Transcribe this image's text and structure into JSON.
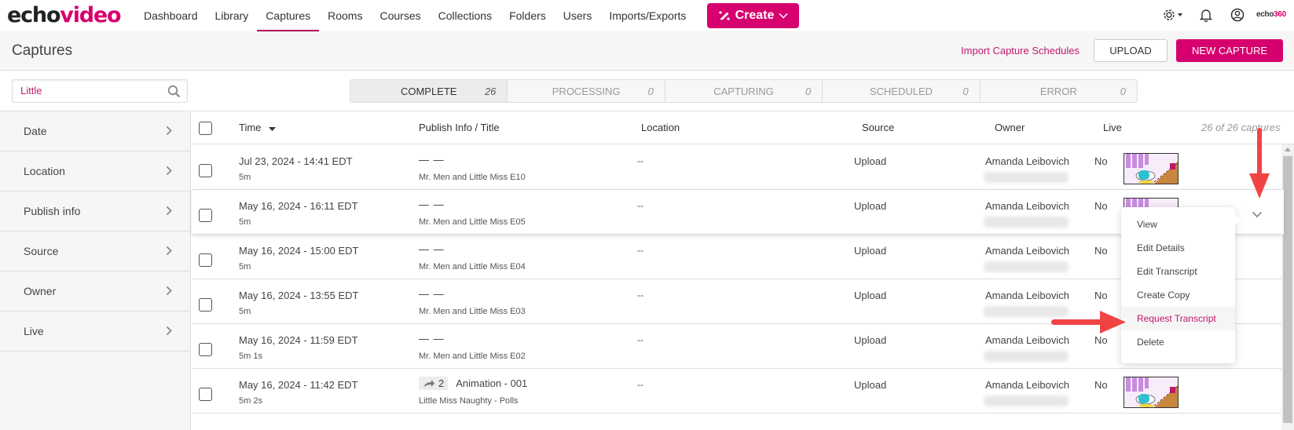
{
  "brand": {
    "logo_part1": "echo",
    "logo_part2": "video",
    "corner_logo_part1": "echo",
    "corner_logo_part2": "360"
  },
  "nav": {
    "items": [
      {
        "label": "Dashboard",
        "active": false
      },
      {
        "label": "Library",
        "active": false
      },
      {
        "label": "Captures",
        "active": true
      },
      {
        "label": "Rooms",
        "active": false
      },
      {
        "label": "Courses",
        "active": false
      },
      {
        "label": "Collections",
        "active": false
      },
      {
        "label": "Folders",
        "active": false
      },
      {
        "label": "Users",
        "active": false
      },
      {
        "label": "Imports/Exports",
        "active": false
      }
    ],
    "create_label": "Create",
    "icons": [
      "magic-wand-icon",
      "gear-icon",
      "bell-icon",
      "user-circle-icon"
    ]
  },
  "header": {
    "title": "Captures",
    "import_link": "Import Capture Schedules",
    "upload_label": "UPLOAD",
    "new_capture_label": "NEW CAPTURE"
  },
  "search": {
    "value": "Little",
    "placeholder": ""
  },
  "status_tabs": [
    {
      "label": "COMPLETE",
      "count": "26",
      "active": true
    },
    {
      "label": "PROCESSING",
      "count": "0",
      "active": false
    },
    {
      "label": "CAPTURING",
      "count": "0",
      "active": false
    },
    {
      "label": "SCHEDULED",
      "count": "0",
      "active": false
    },
    {
      "label": "ERROR",
      "count": "0",
      "active": false
    }
  ],
  "filters": [
    {
      "label": "Date"
    },
    {
      "label": "Location"
    },
    {
      "label": "Publish info"
    },
    {
      "label": "Source"
    },
    {
      "label": "Owner"
    },
    {
      "label": "Live"
    }
  ],
  "table": {
    "columns": {
      "time": "Time",
      "publish": "Publish Info / Title",
      "location": "Location",
      "source": "Source",
      "owner": "Owner",
      "live": "Live"
    },
    "count_note": "26 of 26 captures",
    "rows": [
      {
        "time": "Jul 23, 2024 - 14:41 EDT",
        "duration": "5m",
        "publish": "— —",
        "title": "Mr. Men and Little Miss E10",
        "location": "--",
        "source": "Upload",
        "owner": "Amanda Leibovich",
        "live": "No"
      },
      {
        "time": "May 16, 2024 - 16:11 EDT",
        "duration": "5m",
        "publish": "— —",
        "title": "Mr. Men and Little Miss E05",
        "location": "--",
        "source": "Upload",
        "owner": "Amanda Leibovich",
        "live": "No"
      },
      {
        "time": "May 16, 2024 - 15:00 EDT",
        "duration": "5m",
        "publish": "— —",
        "title": "Mr. Men and Little Miss E04",
        "location": "--",
        "source": "Upload",
        "owner": "Amanda Leibovich",
        "live": "No"
      },
      {
        "time": "May 16, 2024 - 13:55 EDT",
        "duration": "5m",
        "publish": "— —",
        "title": "Mr. Men and Little Miss E03",
        "location": "--",
        "source": "Upload",
        "owner": "Amanda Leibovich",
        "live": "No"
      },
      {
        "time": "May 16, 2024 - 11:59 EDT",
        "duration": "5m 1s",
        "publish": "— —",
        "title": "Mr. Men and Little Miss E02",
        "location": "--",
        "source": "Upload",
        "owner": "Amanda Leibovich",
        "live": "No"
      },
      {
        "time": "May 16, 2024 - 11:42 EDT",
        "duration": "5m 2s",
        "share_count": "2",
        "publish": "Animation - 001",
        "title": "Little Miss Naughty - Polls",
        "location": "--",
        "source": "Upload",
        "owner": "Amanda Leibovich",
        "live": "No"
      }
    ]
  },
  "context_menu": {
    "items": [
      {
        "label": "View",
        "active": false
      },
      {
        "label": "Edit Details",
        "active": false
      },
      {
        "label": "Edit Transcript",
        "active": false
      },
      {
        "label": "Create Copy",
        "active": false
      },
      {
        "label": "Request Transcript",
        "active": true
      },
      {
        "label": "Delete",
        "active": false
      }
    ]
  },
  "colors": {
    "brand": "#d6006e",
    "link": "#c2186e",
    "annotation_arrow": "#f04444"
  }
}
